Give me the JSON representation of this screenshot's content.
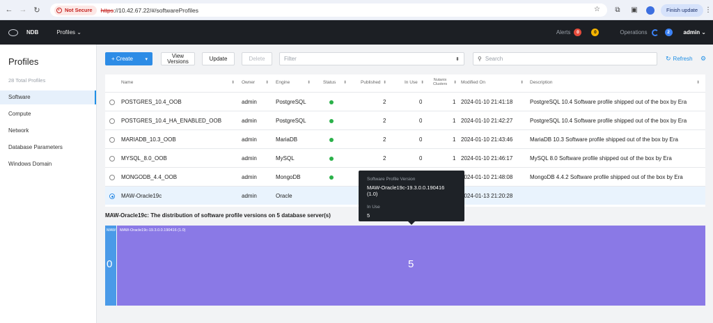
{
  "browser": {
    "security_label": "Not Secure",
    "url_protocol": "https",
    "url_rest": "://10.42.67.22/#/softwareProfiles",
    "finish_update": "Finish update"
  },
  "app": {
    "brand": "NDB",
    "menu": "Profiles ⌄",
    "alerts_label": "Alerts",
    "alerts_critical": "0",
    "alerts_warning": "0",
    "operations_label": "Operations",
    "operations_count": "2",
    "user": "admin ⌄"
  },
  "sidebar": {
    "title": "Profiles",
    "count": "28 Total Profiles",
    "items": [
      {
        "label": "Software",
        "active": true
      },
      {
        "label": "Compute"
      },
      {
        "label": "Network"
      },
      {
        "label": "Database Parameters"
      },
      {
        "label": "Windows Domain"
      }
    ]
  },
  "toolbar": {
    "create": "+ Create",
    "view_versions_1": "View",
    "view_versions_2": "Versions",
    "update": "Update",
    "delete": "Delete",
    "filter_placeholder": "Filter",
    "search_placeholder": "Search",
    "refresh": "Refresh"
  },
  "table": {
    "headers": {
      "name": "Name",
      "owner": "Owner",
      "engine": "Engine",
      "status": "Status",
      "published": "Published",
      "in_use": "In Use",
      "nutanix_1": "Nutanix",
      "nutanix_2": "Clusters",
      "modified": "Modified On",
      "description": "Description"
    },
    "rows": [
      {
        "name": "POSTGRES_10.4_OOB",
        "owner": "admin",
        "engine": "PostgreSQL",
        "published": "2",
        "in_use": "0",
        "clusters": "1",
        "modified": "2024-01-10 21:41:18",
        "description": "PostgreSQL 10.4 Software profile shipped out of the box by Era"
      },
      {
        "name": "POSTGRES_10.4_HA_ENABLED_OOB",
        "owner": "admin",
        "engine": "PostgreSQL",
        "published": "2",
        "in_use": "0",
        "clusters": "1",
        "modified": "2024-01-10 21:42:27",
        "description": "PostgreSQL 10.4 Software profile shipped out of the box by Era"
      },
      {
        "name": "MARIADB_10.3_OOB",
        "owner": "admin",
        "engine": "MariaDB",
        "published": "2",
        "in_use": "0",
        "clusters": "1",
        "modified": "2024-01-10 21:43:46",
        "description": "MariaDB 10.3 Software profile shipped out of the box by Era"
      },
      {
        "name": "MYSQL_8.0_OOB",
        "owner": "admin",
        "engine": "MySQL",
        "published": "2",
        "in_use": "0",
        "clusters": "1",
        "modified": "2024-01-10 21:46:17",
        "description": "MySQL 8.0 Software profile shipped out of the box by Era"
      },
      {
        "name": "MONGODB_4.4_OOB",
        "owner": "admin",
        "engine": "MongoDB",
        "published": "",
        "in_use": "",
        "clusters": "",
        "modified": "2024-01-10 21:48:08",
        "description": "MongoDB 4.4.2 Software profile shipped out of the box by Era"
      },
      {
        "name": "MAW-Oracle19c",
        "owner": "admin",
        "engine": "Oracle",
        "published": "",
        "in_use": "",
        "clusters": "",
        "modified": "2024-01-13 21:20:28",
        "description": ""
      }
    ]
  },
  "distribution": {
    "title": "MAW-Oracle19c: The distribution of software profile versions on 5 database server(s)",
    "segments": [
      {
        "label": "MAW",
        "value": "0",
        "color": "#4a9ae8"
      },
      {
        "label": "MAW-Oracle19c-19.3.0.0.190416 (1.0)",
        "value": "5",
        "color": "#8a79e6"
      }
    ]
  },
  "tooltip": {
    "version_label": "Software Profile Version",
    "version_value": "MAW-Oracle19c-19.3.0.0.190416 (1.0)",
    "inuse_label": "In Use",
    "inuse_value": "5"
  }
}
